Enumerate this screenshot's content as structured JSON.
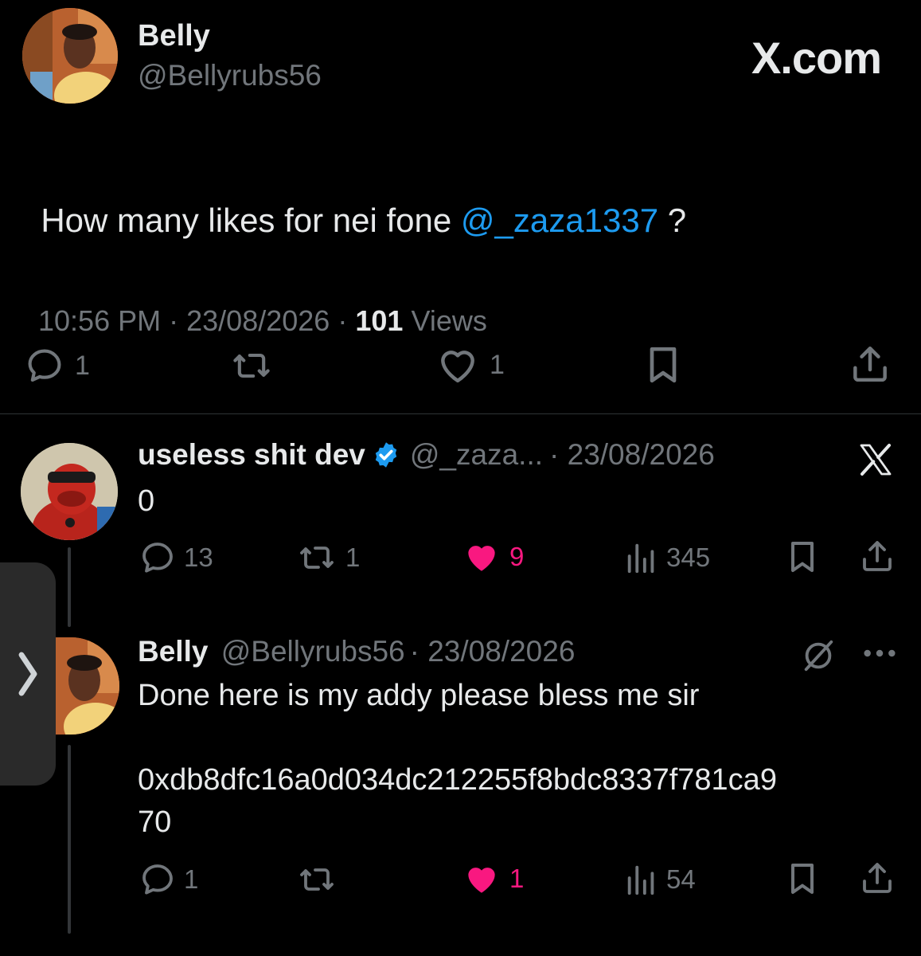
{
  "main_post": {
    "author_name": "Belly",
    "author_handle": "@Bellyrubs56",
    "brand": "X.com",
    "text_before": "How many likes for nei fone ",
    "mention": "@_zaza1337",
    "text_after": " ?",
    "time": "10:56 PM",
    "sep": "·",
    "date": "23/08/2026",
    "views_count": "101",
    "views_label": "Views",
    "reply_count": "1",
    "like_count": "1"
  },
  "reply1": {
    "author_name": "useless shit dev",
    "author_handle": "@_zaza...",
    "date_prefix": "· 23/08/2026",
    "text": "0",
    "reply_count": "13",
    "repost_count": "1",
    "like_count": "9",
    "view_count": "345"
  },
  "reply2": {
    "author_name": "Belly",
    "author_handle": "@Bellyrubs56",
    "date_prefix": "· 23/08/2026",
    "text_line1": "Done here is my addy please bless me sir",
    "text_line2": "0xdb8dfc16a0d034dc212255f8bdc8337f781ca9",
    "text_line3": "70",
    "reply_count": "1",
    "like_count": "1",
    "view_count": "54"
  },
  "colors": {
    "background": "#000000",
    "text": "#e7e9ea",
    "muted": "#71767b",
    "link": "#1d9bf0",
    "like_pink": "#f91880",
    "verified_blue": "#1d9bf0"
  }
}
